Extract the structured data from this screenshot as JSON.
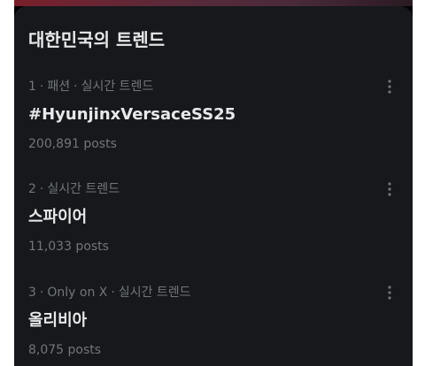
{
  "section_title": "대한민국의 트렌드",
  "trends": [
    {
      "rank": "1",
      "category": "패션",
      "label": "실시간 트렌드",
      "name": "#HyunjinxVersaceSS25",
      "posts": "200,891 posts"
    },
    {
      "rank": "2",
      "label": "실시간 트렌드",
      "name": "스파이어",
      "posts": "11,033 posts"
    },
    {
      "rank": "3",
      "category": "Only on X",
      "label": "실시간 트렌드",
      "name": "올리비아",
      "posts": "8,075 posts"
    }
  ],
  "separator": "·",
  "icons": {
    "more": "more-vertical-icon"
  },
  "colors": {
    "background": "#16181c",
    "primary_text": "#e7e9ea",
    "secondary_text": "#71767b"
  }
}
